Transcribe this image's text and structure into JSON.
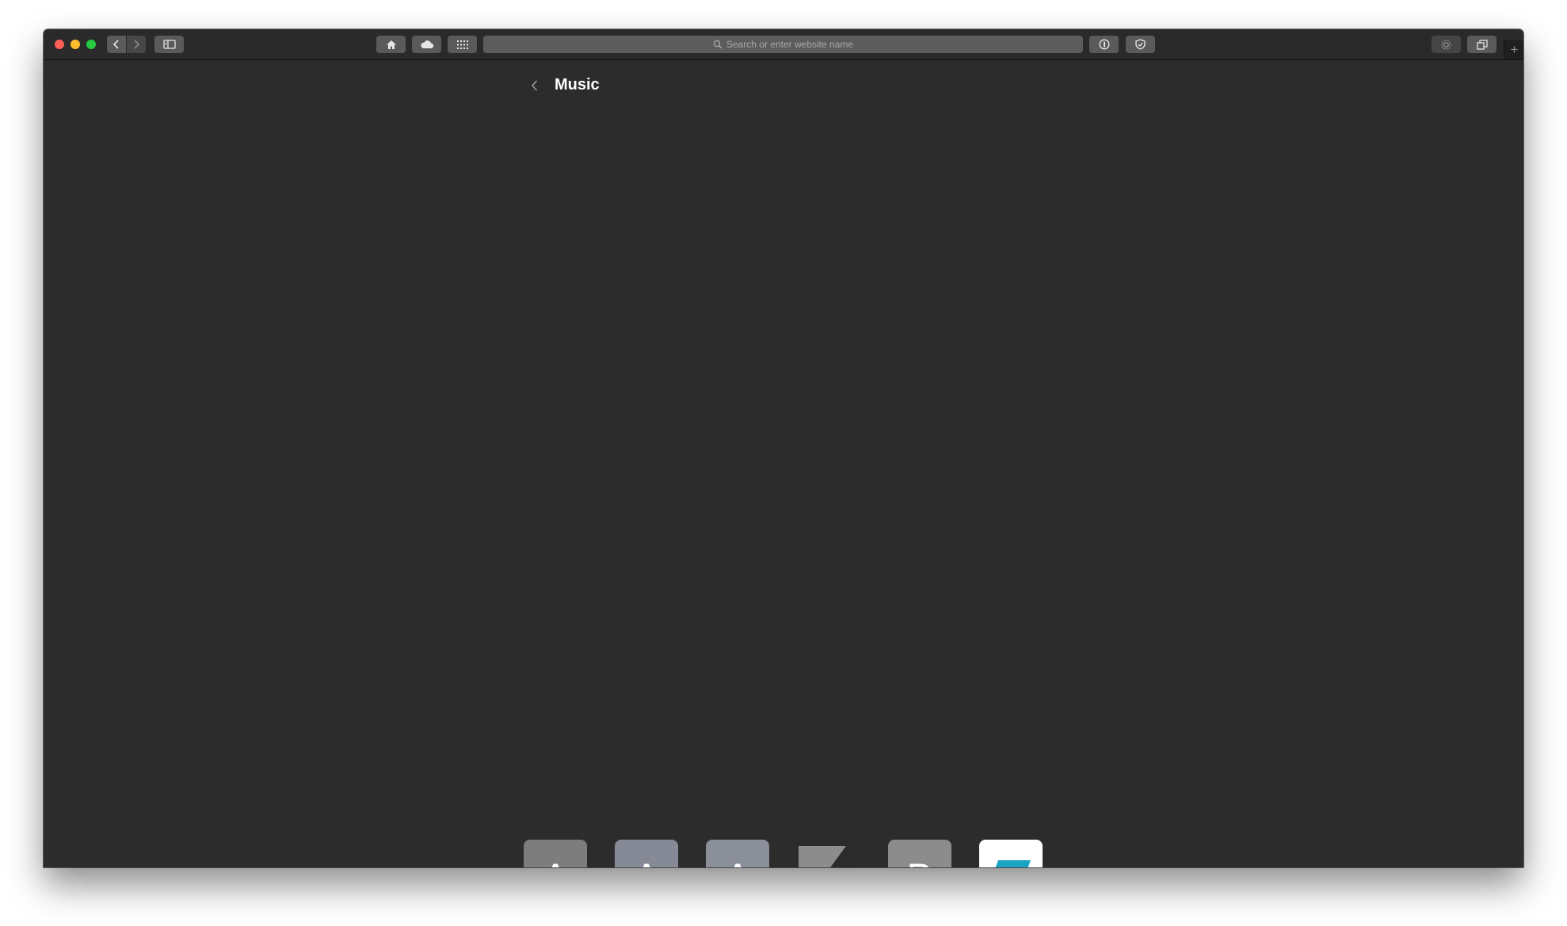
{
  "browser": {
    "address_placeholder": "Search or enter website name",
    "new_tab_label": "+"
  },
  "page": {
    "title": "Music"
  },
  "tiles": [
    {
      "letter": "A",
      "color": "#7d7d7d"
    },
    {
      "letter": "A",
      "color": "#858a96"
    },
    {
      "letter": "A",
      "color": "#8a8f99"
    },
    {
      "icon": "red-slash-logo-icon",
      "color": "#2b2b2b",
      "accent": "#e3263a"
    },
    {
      "letter": "B",
      "color": "#8c8c8c"
    },
    {
      "icon": "blue-parallelogram-logo-icon",
      "color": "#ffffff",
      "accent": "#1aa3c2"
    }
  ]
}
